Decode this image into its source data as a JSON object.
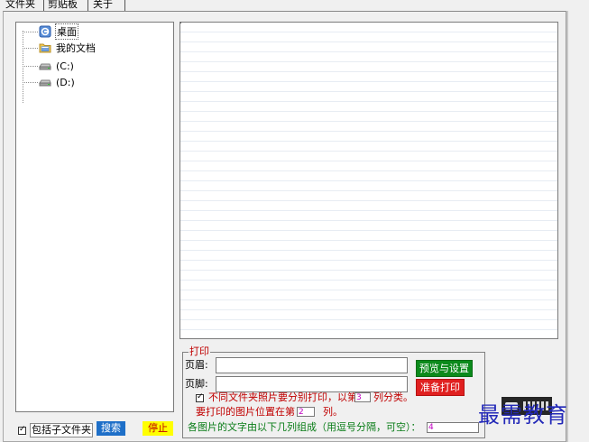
{
  "tabs": [
    {
      "label": "文件夹",
      "active": true
    },
    {
      "label": "剪贴板",
      "active": false
    },
    {
      "label": "关于",
      "active": false
    }
  ],
  "tree": {
    "items": [
      {
        "label": "桌面",
        "icon": "desktop-icon",
        "selected": true
      },
      {
        "label": "我的文档",
        "icon": "folder-icon",
        "selected": false
      },
      {
        "label": "(C:)",
        "icon": "drive-icon",
        "selected": false
      },
      {
        "label": "(D:)",
        "icon": "drive-icon",
        "selected": false
      }
    ]
  },
  "print": {
    "legend": "打印",
    "header_label": "页眉:",
    "header_value": "",
    "footer_label": "页脚:",
    "footer_value": "",
    "preview_button": "预览与设置",
    "print_button": "准备打印",
    "separate_checked": true,
    "separate_prefix": "不同文件夹照片要分别打印，以第",
    "separate_column": "3",
    "separate_suffix": "列分类。",
    "position_prefix": "要打印的图片位置在第",
    "position_column": "2",
    "position_suffix": "列。",
    "text_columns_label": "各图片的文字由以下几列组成（用逗号分隔，可空）：",
    "text_columns_value": "4"
  },
  "bottom": {
    "include_subfolders_checked": true,
    "include_subfolders_label": "包括子文件夹",
    "search_button": "搜索",
    "stop_button": "停止"
  },
  "watermark": {
    "text": "最需教育"
  },
  "colors": {
    "green_button": "#0b8a1b",
    "red_button": "#e02020",
    "search_button": "#1e6fc8",
    "stop_button": "#ffff00",
    "label_red": "#c00000",
    "label_green": "#0a7d18",
    "watermark_blue": "#2228b8"
  }
}
